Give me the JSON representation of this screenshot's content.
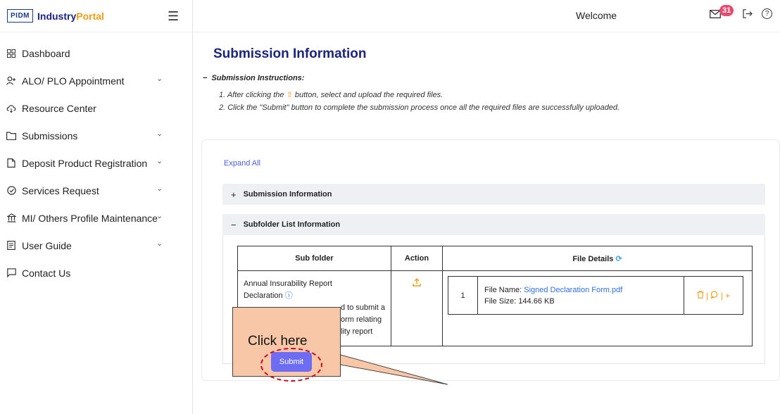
{
  "brand": {
    "logo": "PIDM",
    "name_part1": "Industry",
    "name_part2": "Portal"
  },
  "sidebar": {
    "items": [
      {
        "label": "Dashboard",
        "icon": "grid-icon",
        "chevron": false
      },
      {
        "label": "ALO/ PLO Appointment",
        "icon": "user-add-icon",
        "chevron": true
      },
      {
        "label": "Resource Center",
        "icon": "cloud-icon",
        "chevron": false
      },
      {
        "label": "Submissions",
        "icon": "folder-icon",
        "chevron": true
      },
      {
        "label": "Deposit Product Registration",
        "icon": "document-icon",
        "chevron": true
      },
      {
        "label": "Services Request",
        "icon": "badge-icon",
        "chevron": true
      },
      {
        "label": "MI/ Others Profile Maintenance",
        "icon": "bank-icon",
        "chevron": true
      },
      {
        "label": "User Guide",
        "icon": "guide-icon",
        "chevron": true
      },
      {
        "label": "Contact Us",
        "icon": "message-icon",
        "chevron": false
      }
    ]
  },
  "topbar": {
    "welcome": "Welcome",
    "mail_count": "31"
  },
  "main": {
    "title": "Submission Information",
    "instructions_head": "Submission Instructions:",
    "instr1_before": "1. After clicking the",
    "instr1_after": "button, select and upload the required files.",
    "instr2": "2. Click the \"Submit\" button to complete the submission process once all the required files are successfully uploaded.",
    "expand_all": "Expand All",
    "accordion1": "Submission Information",
    "accordion2": "Subfolder List Information",
    "table": {
      "headers": [
        "Sub folder",
        "Action",
        "File Details"
      ],
      "row": {
        "name_line1": "Annual Insurability Report",
        "name_line2": "Declaration",
        "desc1": "d to submit a",
        "desc2": "orm relating",
        "desc3": "lity report",
        "file_no": "1",
        "file_name_label": "File Name:",
        "file_name": "Signed Declaration Form.pdf",
        "file_size_label": "File Size:",
        "file_size": "144.66 KB"
      }
    },
    "submit_label": "Submit",
    "callout": "Click here"
  },
  "colors": {
    "primary": "#1a237e",
    "accent": "#f39c12",
    "submit": "#6c6cf5",
    "badge": "#e84a6f",
    "callout": "#f8c7a8",
    "highlight": "#d0021b"
  }
}
